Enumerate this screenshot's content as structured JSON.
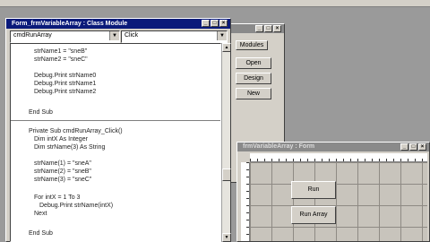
{
  "code_window": {
    "title": "Form_frmVariableArray : Class Module",
    "object_combo": "cmdRunArray",
    "procedure_combo": "Click",
    "lines_top": [
      "strName1 = \"sneB\"",
      "strName2 = \"sneC\"",
      "",
      "Debug.Print strName0",
      "Debug.Print strName1",
      "Debug.Print strName2",
      "",
      "End Sub"
    ],
    "lines_bottom": [
      "Private Sub cmdRunArray_Click()",
      "Dim intX As Integer",
      "Dim strName(3) As String",
      "",
      "strName(1) = \"sneA\"",
      "strName(2) = \"sneB\"",
      "strName(3) = \"sneC\"",
      "",
      "For intX = 1 To 3",
      "Debug.Print strName(intX)",
      "Next",
      "",
      "End Sub"
    ]
  },
  "modules_window": {
    "tab_label": "Modules",
    "buttons": [
      "Open",
      "Design",
      "New"
    ]
  },
  "form_window": {
    "title": "frmVariableArray : Form",
    "run_button": "Run",
    "run_array_button": "Run Array"
  },
  "colors": {
    "active_title": "#0a1a7a",
    "inactive_title": "#8a8a8a",
    "chrome": "#d4d0c8",
    "form_grid": "#c8c4bc"
  }
}
